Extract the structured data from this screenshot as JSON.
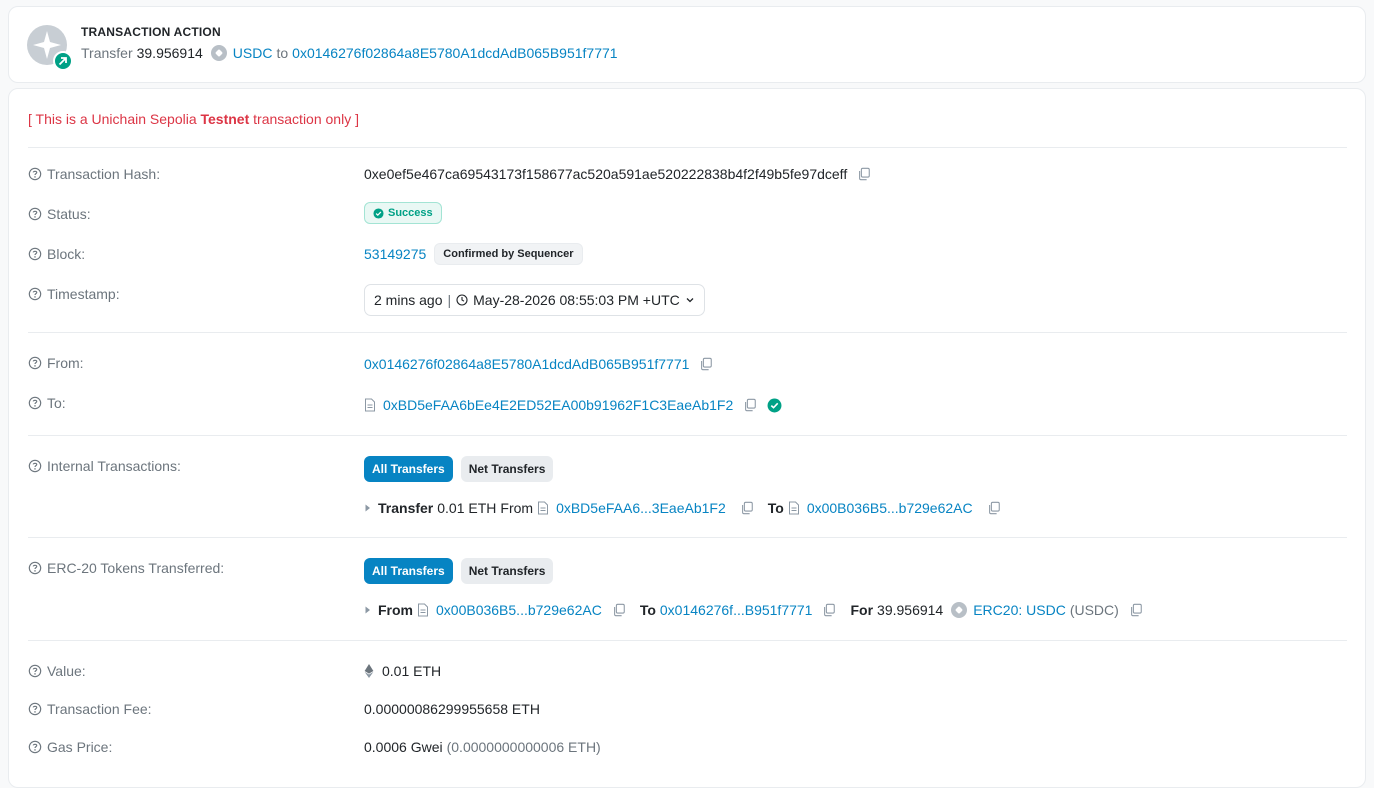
{
  "action": {
    "title": "TRANSACTION ACTION",
    "transfer_label": "Transfer",
    "amount": "39.956914",
    "token": "USDC",
    "to_label": "to",
    "to_address": "0x0146276f02864a8E5780A1dcdAdB065B951f7771"
  },
  "note": {
    "prefix": "[ This is a Unichain Sepolia ",
    "emphasis": "Testnet",
    "suffix": " transaction only ]"
  },
  "hash": {
    "label": "Transaction Hash:",
    "value": "0xe0ef5e467ca69543173f158677ac520a591ae520222838b4f2f49b5fe97dceff"
  },
  "status": {
    "label": "Status:",
    "value": "Success"
  },
  "block": {
    "label": "Block:",
    "number": "53149275",
    "badge": "Confirmed by Sequencer"
  },
  "timestamp": {
    "label": "Timestamp:",
    "ago": "2 mins ago",
    "separator": "|",
    "date": "May-28-2026 08:55:03 PM +UTC"
  },
  "from": {
    "label": "From:",
    "address": "0x0146276f02864a8E5780A1dcdAdB065B951f7771"
  },
  "to": {
    "label": "To:",
    "address": "0xBD5eFAA6bEe4E2ED52EA00b91962F1C3EaeAb1F2"
  },
  "internal": {
    "label": "Internal Transactions:",
    "btn_all": "All Transfers",
    "btn_net": "Net Transfers",
    "transfer_word": "Transfer",
    "amount": "0.01 ETH",
    "from_word": "From",
    "from_addr": "0xBD5eFAA6...3EaeAb1F2",
    "to_word": "To",
    "to_addr": "0x00B036B5...b729e62AC"
  },
  "erc20": {
    "label": "ERC-20 Tokens Transferred:",
    "btn_all": "All Transfers",
    "btn_net": "Net Transfers",
    "from_word": "From",
    "from_addr": "0x00B036B5...b729e62AC",
    "to_word": "To",
    "to_addr": "0x0146276f...B951f7771",
    "for_word": "For",
    "amount": "39.956914",
    "token_link": "ERC20: USDC",
    "token_symbol": "(USDC)"
  },
  "value": {
    "label": "Value:",
    "amount": "0.01 ETH"
  },
  "fee": {
    "label": "Transaction Fee:",
    "amount": "0.00000086299955658 ETH"
  },
  "gas": {
    "label": "Gas Price:",
    "amount": "0.0006 Gwei",
    "detail": "(0.0000000000006 ETH)"
  },
  "colors": {
    "accent": "#0784c3",
    "success": "#00a186",
    "danger": "#dc3545",
    "muted": "#6c757d"
  }
}
